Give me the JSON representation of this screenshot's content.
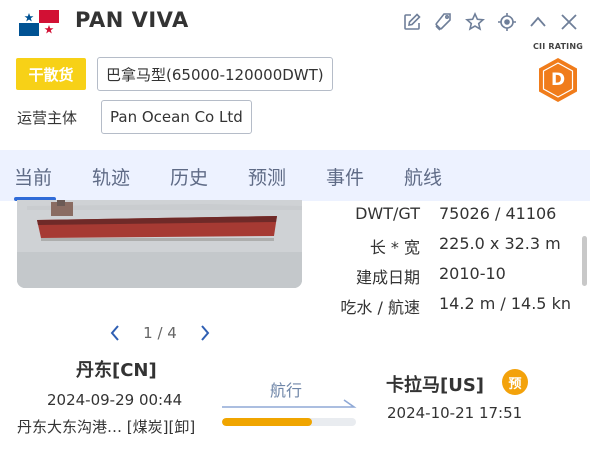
{
  "vessel": {
    "name": "PAN VIVA",
    "flag": "panama-flag"
  },
  "header_icons": [
    "edit-icon",
    "tag-icon",
    "star-icon",
    "locate-icon",
    "collapse-icon",
    "close-icon"
  ],
  "cii": {
    "label": "CII RATING",
    "grade": "D",
    "color": "#f07c1b"
  },
  "tags": {
    "cargo_type": "干散货",
    "ship_class": "巴拿马型(65000-120000DWT)",
    "operator_label": "运营主体",
    "operator": "Pan Ocean Co Ltd"
  },
  "tabs": [
    {
      "label": "当前"
    },
    {
      "label": "轨迹"
    },
    {
      "label": "历史"
    },
    {
      "label": "预测"
    },
    {
      "label": "事件"
    },
    {
      "label": "航线"
    }
  ],
  "specs": [
    {
      "label": "DWT/GT",
      "value": "75026 / 41106"
    },
    {
      "label": "长 * 宽",
      "value": "225.0 x 32.3 m"
    },
    {
      "label": "建成日期",
      "value": "2010-10"
    },
    {
      "label": "吃水 / 航速",
      "value": "14.2 m / 14.5 kn"
    }
  ],
  "pager": {
    "text": "1 / 4"
  },
  "voyage": {
    "from_port": "丹东[CN]",
    "from_time": "2024-09-29 00:44",
    "from_detail": "丹东大东沟港… [煤炭][卸]",
    "status": "航行",
    "progress_pct": 67,
    "to_port": "卡拉马[US]",
    "eta_badge": "预",
    "to_time": "2024-10-21 17:51"
  },
  "colors": {
    "accent": "#2f6bd8",
    "tab_bg": "#edf2ff",
    "cargo_tag": "#f7d117",
    "progress": "#f0a500"
  }
}
